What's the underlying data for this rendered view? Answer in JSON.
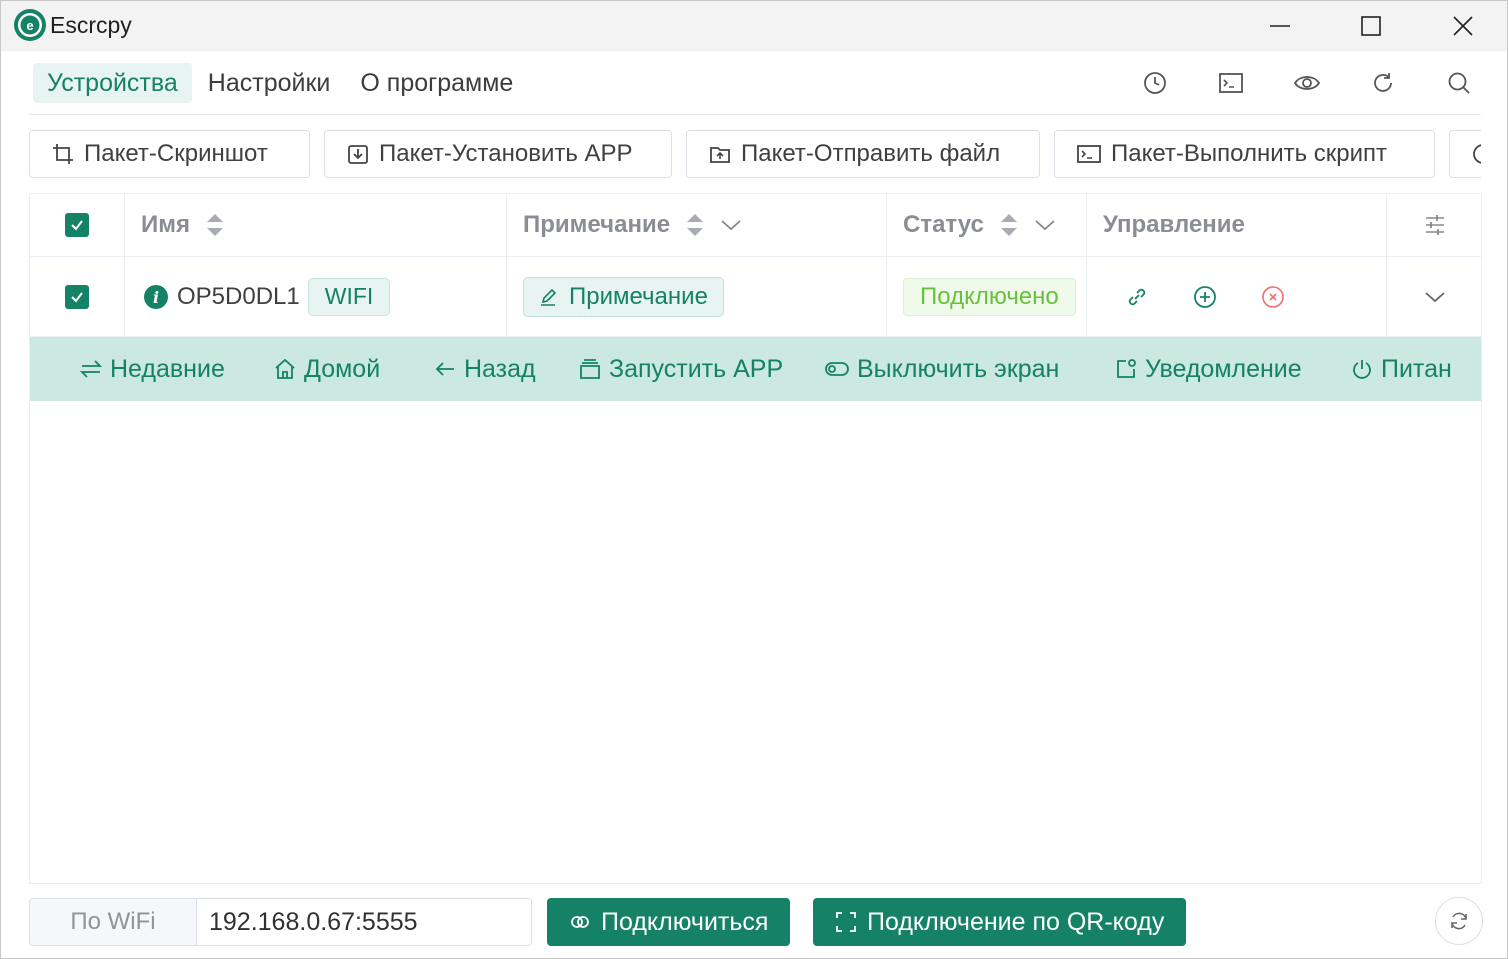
{
  "window": {
    "title": "Escrcpy"
  },
  "nav": {
    "tabs": [
      {
        "label": "Устройства",
        "active": true
      },
      {
        "label": "Настройки",
        "active": false
      },
      {
        "label": "О программе",
        "active": false
      }
    ],
    "icons": [
      "history-icon",
      "terminal-icon",
      "eye-icon",
      "refresh-icon",
      "search-icon"
    ]
  },
  "batch": {
    "screenshot": "Пакет-Скриншот",
    "install_app": "Пакет-Установить APP",
    "send_file": "Пакет-Отправить файл",
    "run_script": "Пакет-Выполнить скрипт"
  },
  "table": {
    "headers": {
      "name": "Имя",
      "note": "Примечание",
      "status": "Статус",
      "control": "Управление"
    },
    "rows": [
      {
        "checked": true,
        "name": "OP5D0DL1",
        "connection_tag": "WIFI",
        "note_button": "Примечание",
        "status": "Подключено"
      }
    ],
    "select_all_checked": true
  },
  "expand_toolbar": {
    "recent": "Недавние",
    "home": "Домой",
    "back": "Назад",
    "launch_app": "Запустить APP",
    "screen_off": "Выключить экран",
    "notification": "Уведомление",
    "power": "Питан"
  },
  "bottom": {
    "mode_label": "По WiFi",
    "address_value": "192.168.0.67:5555",
    "connect_button": "Подключиться",
    "qr_button": "Подключение по QR-коду"
  },
  "colors": {
    "primary": "#158267",
    "primary_light": "#e8f4f1",
    "expand_bg": "#cbe8e1",
    "success": "#67c23a",
    "danger": "#f56c6c"
  }
}
